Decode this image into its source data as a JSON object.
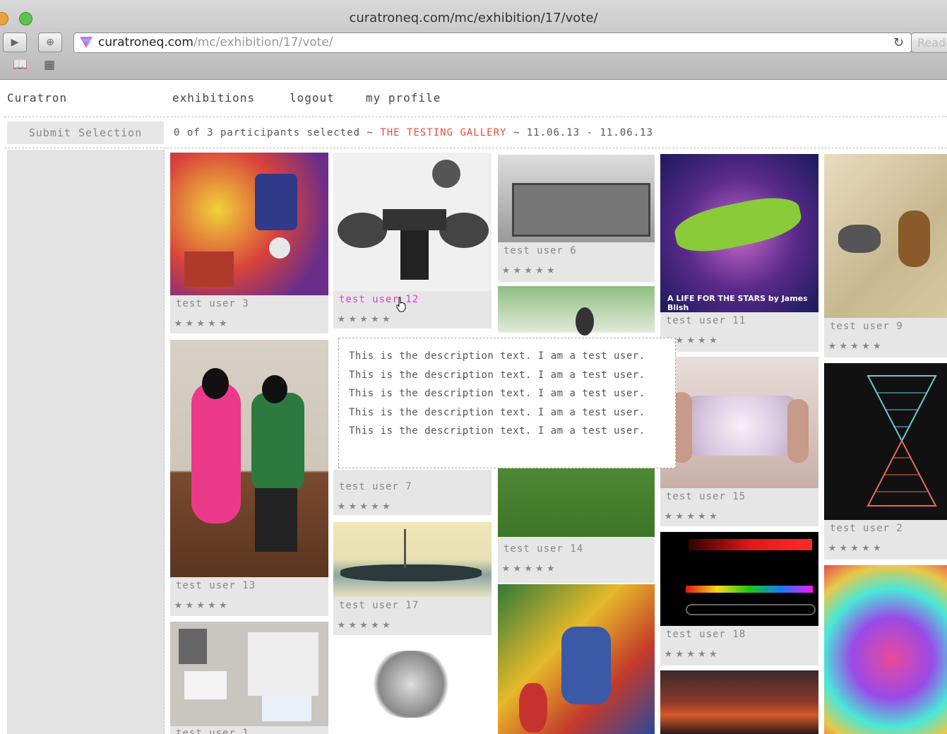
{
  "browser": {
    "title": "curatroneq.com/mc/exhibition/17/vote/",
    "url_host": "curatroneq.com",
    "url_path": "/mc/exhibition/17/vote/",
    "reader_label": "Reader"
  },
  "nav": {
    "brand": "Curatron",
    "links": [
      "exhibitions",
      "logout",
      "my profile"
    ]
  },
  "toolbar": {
    "submit_label": "Submit Selection",
    "status_prefix": "0 of 3 participants selected ~ ",
    "gallery_name": "THE TESTING GALLERY",
    "date_range": " ~ 11.06.13 - 11.06.13"
  },
  "cards": [
    {
      "name": "test user 3",
      "stars": "★★★★★"
    },
    {
      "name": "test user 12",
      "stars": "★★★★★"
    },
    {
      "name": "test user 6",
      "stars": "★★★★★"
    },
    {
      "name": "test user 11",
      "stars": "★★★★★"
    },
    {
      "name": "test user 9",
      "stars": "★★★★★"
    },
    {
      "name": "test user 13",
      "stars": "★★★★★"
    },
    {
      "name": "test user 7",
      "stars": "★★★★★"
    },
    {
      "name": "test user 14",
      "stars": "★★★★★"
    },
    {
      "name": "test user 15",
      "stars": "★★★★★"
    },
    {
      "name": "test user 2",
      "stars": "★★★★★"
    },
    {
      "name": "test user 17",
      "stars": "★★★★★"
    },
    {
      "name": "test user 18",
      "stars": "★★★★★"
    },
    {
      "name": "test user 1",
      "stars": ""
    }
  ],
  "tooltip": {
    "text": "This is the description text. I am a test user. This is the description text. I am a test user. This is the description text. I am a test user. This is the description text. I am a test user. This is the description text. I am a test user."
  },
  "colors": {
    "accent": "#e0503a",
    "highlight": "#e040d0",
    "card_bg": "#e6e6e6"
  }
}
